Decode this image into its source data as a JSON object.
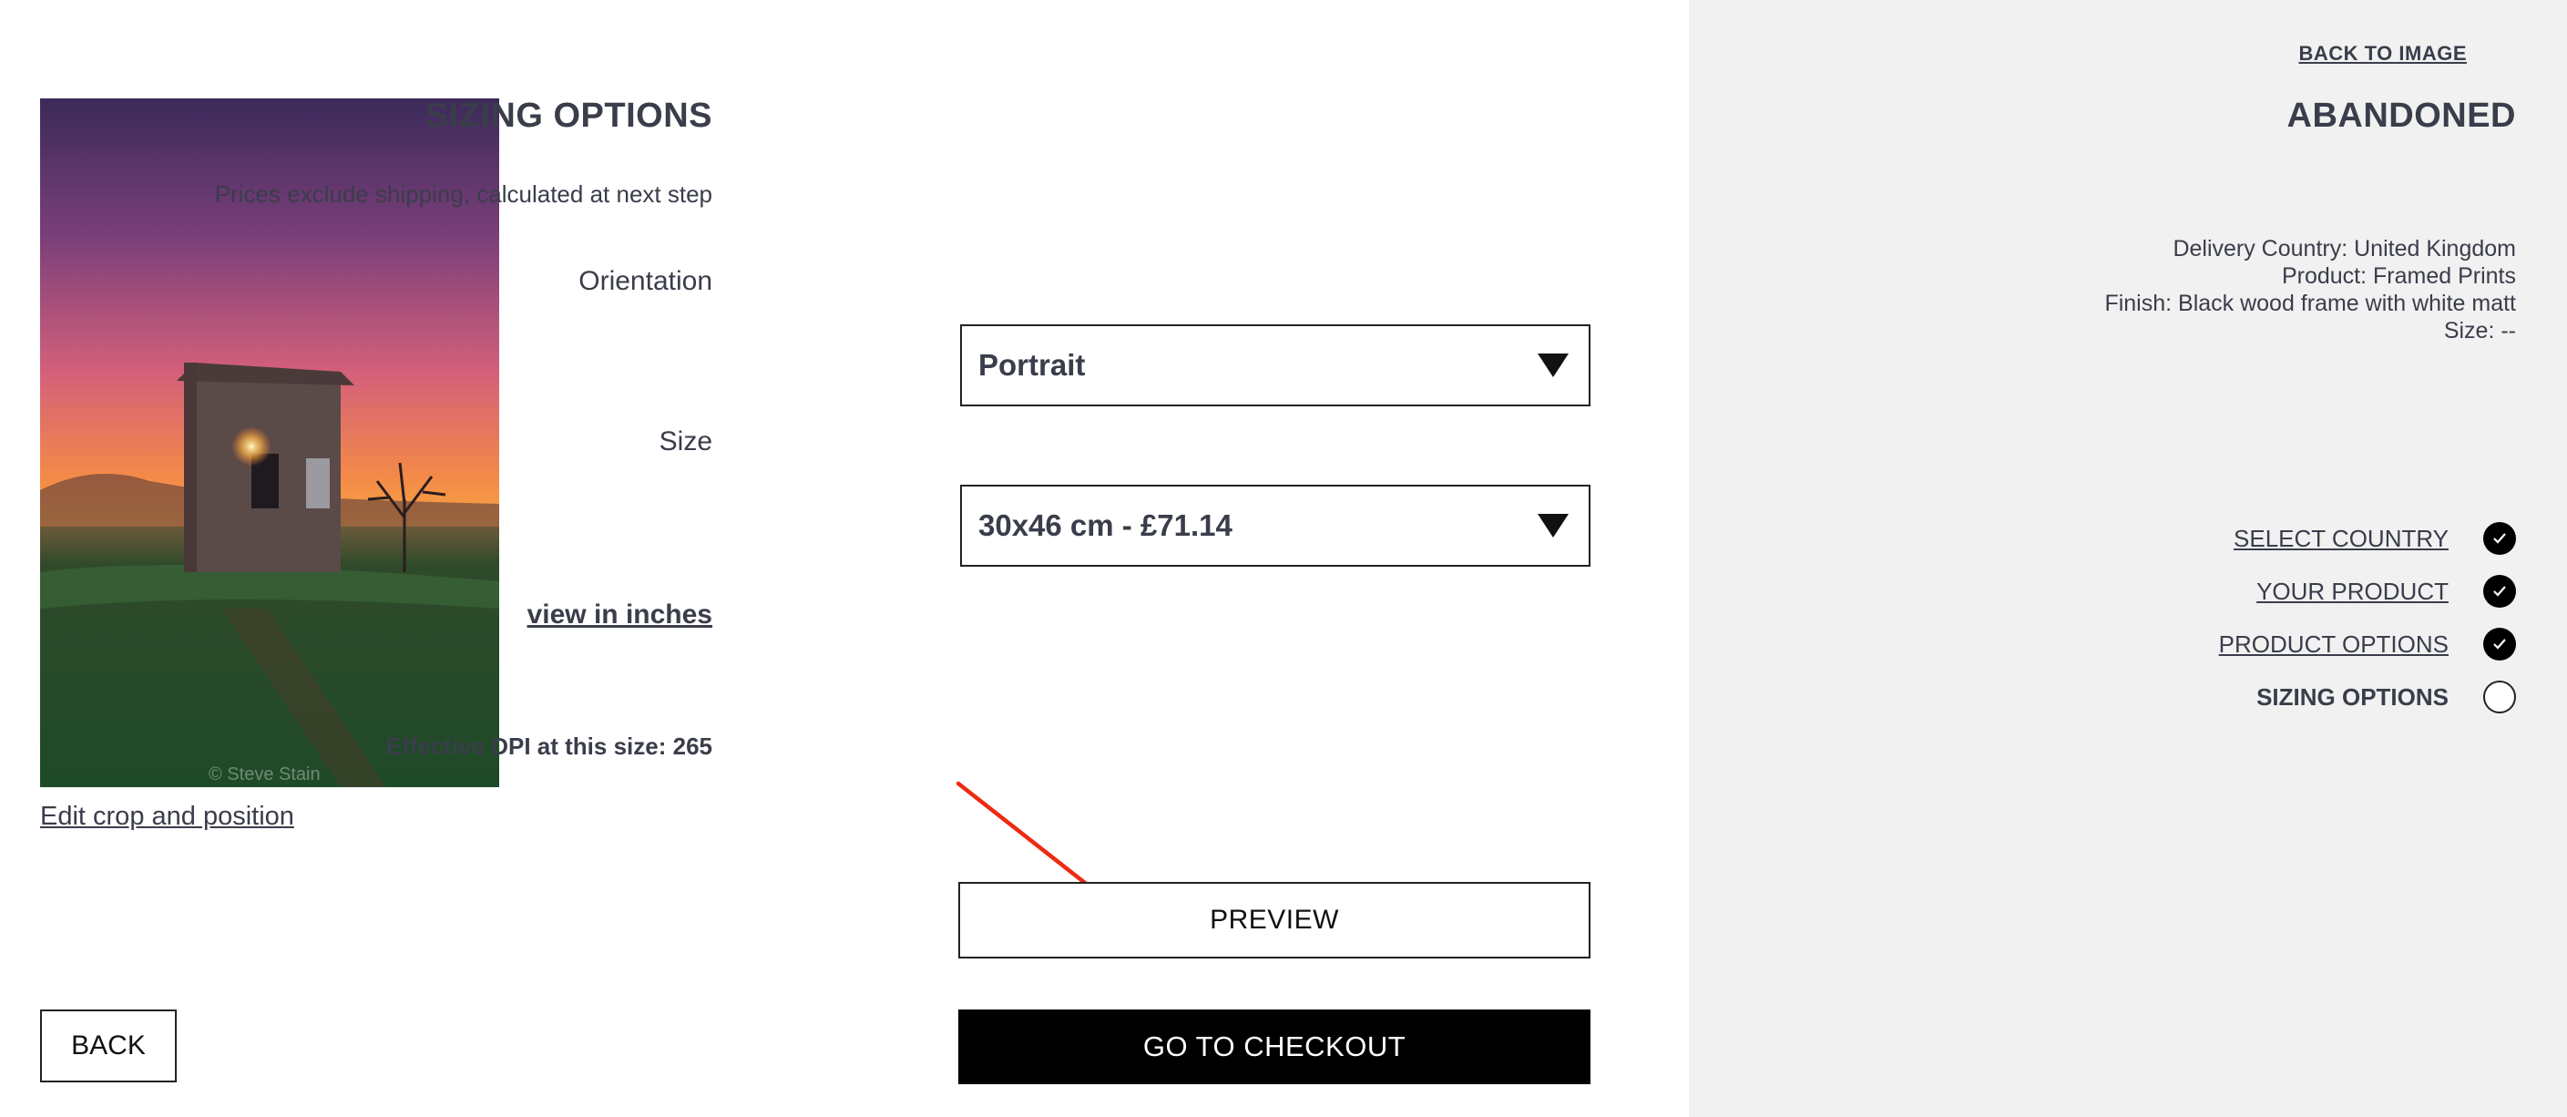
{
  "photo": {
    "alt": "Abandoned shed in field at sunset",
    "watermark": "© Steve Stain"
  },
  "edit_crop_label": "Edit crop and position",
  "back_label": "BACK",
  "sizing": {
    "title": "SIZING OPTIONS",
    "prices_note": "Prices exclude shipping, calculated at next step",
    "orientation_label": "Orientation",
    "orientation_value": "Portrait",
    "size_label": "Size",
    "size_value": "30x46 cm - £71.14",
    "inches_link": "view in inches",
    "dpi_text": "Effective DPI at this size: 265",
    "preview_label": "PREVIEW",
    "checkout_label": "GO TO CHECKOUT"
  },
  "sidebar": {
    "back_to_image": "BACK TO IMAGE",
    "product_title": "ABANDONED",
    "details": [
      "Delivery Country: United Kingdom",
      "Product: Framed Prints",
      "Finish: Black wood frame with white matt",
      "Size: --"
    ],
    "steps": [
      {
        "label": "SELECT COUNTRY",
        "done": true,
        "icon": "check-icon"
      },
      {
        "label": "YOUR PRODUCT",
        "done": true,
        "icon": "check-icon"
      },
      {
        "label": "PRODUCT OPTIONS",
        "done": true,
        "icon": "check-icon"
      },
      {
        "label": "SIZING OPTIONS",
        "done": false,
        "icon": "empty-circle-icon"
      }
    ]
  },
  "colors": {
    "annotation_arrow": "#ee2a12",
    "sidebar_bg": "#f1f1f1",
    "text": "#3a3d4a"
  }
}
